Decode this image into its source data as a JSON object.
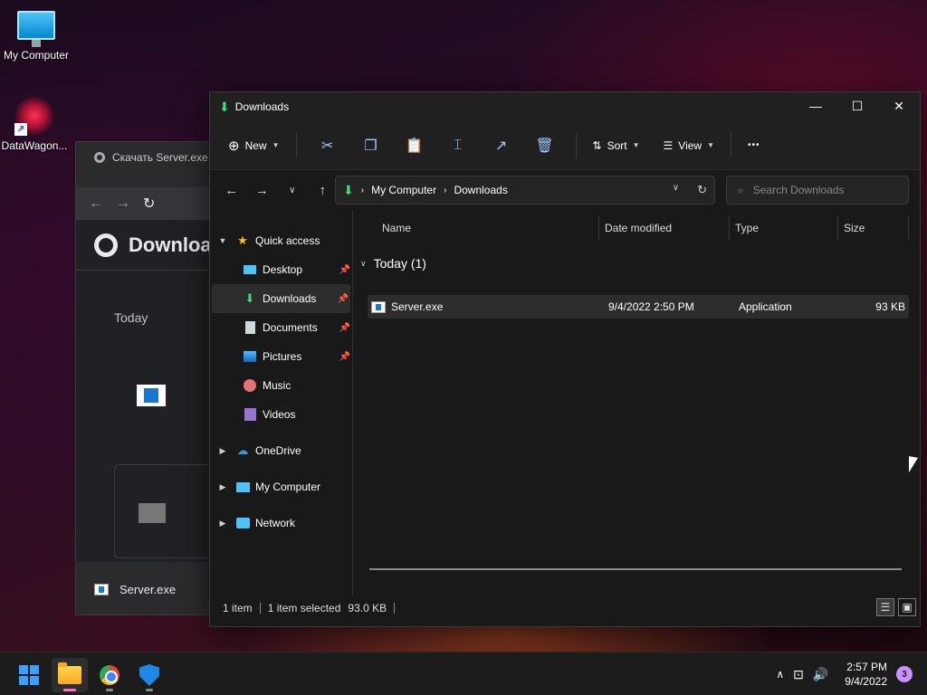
{
  "desktop": {
    "icons": [
      {
        "label": "My Computer"
      },
      {
        "label": "DataWagon..."
      }
    ]
  },
  "chrome": {
    "tab_title": "Скачать Server.exe",
    "page_title": "Downloa",
    "section": "Today",
    "download_file": "Server.exe"
  },
  "explorer": {
    "title": "Downloads",
    "toolbar": {
      "new_label": "New",
      "sort_label": "Sort",
      "view_label": "View",
      "more": "•••"
    },
    "breadcrumb": [
      "My Computer",
      "Downloads"
    ],
    "search_placeholder": "Search Downloads",
    "nav": {
      "quick_access": "Quick access",
      "items": [
        {
          "label": "Desktop",
          "pinned": true
        },
        {
          "label": "Downloads",
          "pinned": true,
          "selected": true
        },
        {
          "label": "Documents",
          "pinned": true
        },
        {
          "label": "Pictures",
          "pinned": true
        },
        {
          "label": "Music",
          "pinned": false
        },
        {
          "label": "Videos",
          "pinned": false
        }
      ],
      "onedrive": "OneDrive",
      "my_computer": "My Computer",
      "network": "Network"
    },
    "columns": {
      "name": "Name",
      "date": "Date modified",
      "type": "Type",
      "size": "Size"
    },
    "group": "Today (1)",
    "files": [
      {
        "name": "Server.exe",
        "date": "9/4/2022 2:50 PM",
        "type": "Application",
        "size": "93 KB"
      }
    ],
    "status": {
      "count": "1 item",
      "selected": "1 item selected",
      "size": "93.0 KB"
    }
  },
  "taskbar": {
    "time": "2:57 PM",
    "date": "9/4/2022",
    "notifications": "3"
  }
}
